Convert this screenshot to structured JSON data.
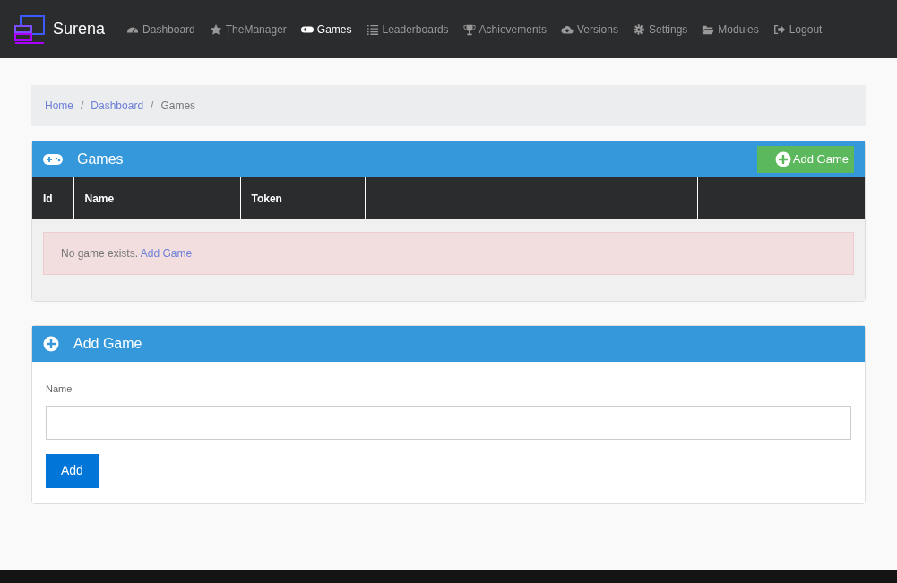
{
  "brand": {
    "name": "Surena"
  },
  "nav": [
    {
      "label": "Dashboard",
      "selected": false
    },
    {
      "label": "TheManager",
      "selected": false
    },
    {
      "label": "Games",
      "selected": true
    },
    {
      "label": "Leaderboards",
      "selected": false
    },
    {
      "label": "Achievements",
      "selected": false
    },
    {
      "label": "Versions",
      "selected": false
    },
    {
      "label": "Settings",
      "selected": false
    },
    {
      "label": "Modules",
      "selected": false
    },
    {
      "label": "Logout",
      "selected": false
    }
  ],
  "breadcrumb": [
    {
      "label": "Home",
      "link": true
    },
    {
      "separator": "/",
      "label": "Dashboard",
      "link": true
    },
    {
      "separator": "/",
      "label": "Games",
      "link": false
    }
  ],
  "games_panel": {
    "title": "Games",
    "add_button": "Add Game",
    "columns": [
      {
        "label": "Id"
      },
      {
        "label": "Name"
      },
      {
        "label": "Token"
      },
      {},
      {}
    ],
    "empty_message": "No game exists.",
    "empty_link": "Add Game"
  },
  "add_panel": {
    "title": "Add Game",
    "field_label": "Name",
    "button": "Add"
  }
}
